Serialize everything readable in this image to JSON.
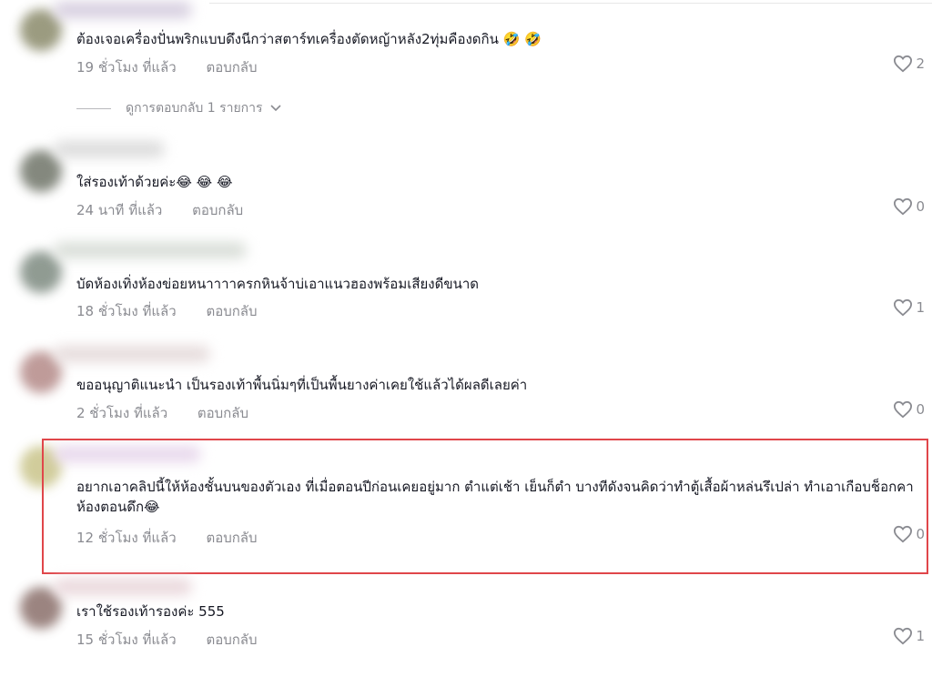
{
  "comments": [
    {
      "text": "ต้องเจอเครื่องปั่นพริกแบบดึงนีกว่าสตาร์ทเครื่องตัดหญ้าหลัง2ทุ่มคืองดกิน 🤣 🤣",
      "time": "19 ชั่วโมง ที่แล้ว",
      "reply": "ตอบกลับ",
      "likes": "2",
      "view_replies": "ดูการตอบกลับ 1 รายการ"
    },
    {
      "text": "ใส่รองเท้าด้วยค่ะ😂 😂 😂",
      "time": "24 นาที ที่แล้ว",
      "reply": "ตอบกลับ",
      "likes": "0"
    },
    {
      "text": "บัดห้องเทิ่งห้องข่อยหนาาาาครกหินจ้าบ่เอาแนวฮองพร้อมเสียงดีขนาด",
      "time": "18 ชั่วโมง ที่แล้ว",
      "reply": "ตอบกลับ",
      "likes": "1"
    },
    {
      "text": "ขออนุญาติแนะนำ เป็นรองเท้าพื้นนิ่มๆที่เป็นพื้นยางค่าเคยใช้แล้วได้ผลดีเลยค่า",
      "time": "2 ชั่วโมง ที่แล้ว",
      "reply": "ตอบกลับ",
      "likes": "0"
    },
    {
      "text": "อยากเอาคลิปนี้ให้ห้องชั้นบนของตัวเอง ที่เมื่อตอนปีก่อนเคยอยู่มาก ตำแต่เช้า เย็นก็ตำ บางทีดังจนคิดว่าทำตู้เสื้อผ้าหล่นรึเปล่า ทำเอาเกือบช็อกคาห้องตอนดึก😂",
      "time": "12 ชั่วโมง ที่แล้ว",
      "reply": "ตอบกลับ",
      "likes": "0"
    },
    {
      "text": "เราใช้รองเท้ารองค่ะ 555",
      "time": "15 ชั่วโมง ที่แล้ว",
      "reply": "ตอบกลับ",
      "likes": "1"
    }
  ],
  "colors": {
    "highlight": "#e0464a",
    "muted_text": "#8a8b91",
    "body_text": "#161823"
  },
  "icons": {
    "like": "heart-outline-icon",
    "expand": "chevron-down-icon"
  }
}
